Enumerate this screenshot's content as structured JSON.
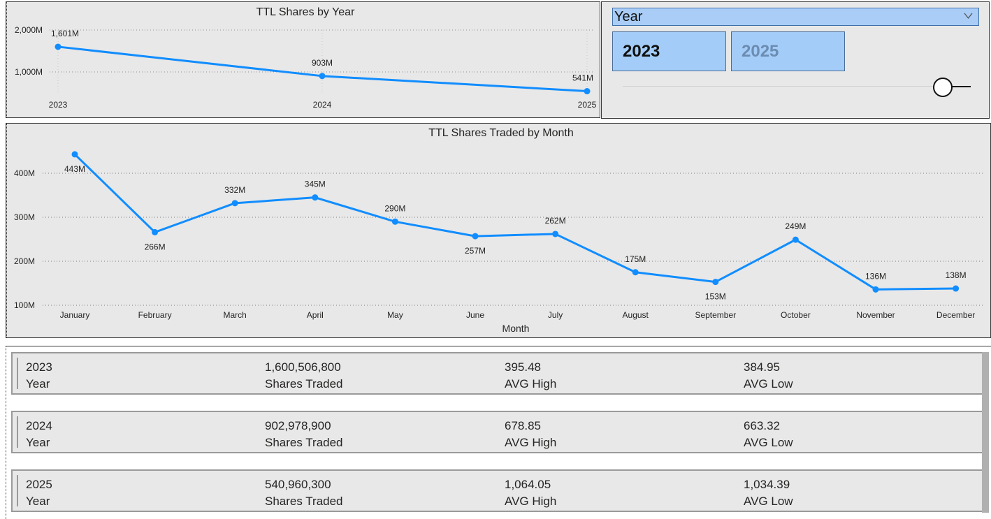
{
  "year_chart": {
    "title": "TTL Shares by Year",
    "chart_data": {
      "type": "line",
      "title": "TTL Shares by Year",
      "categories": [
        "2023",
        "2024",
        "2025"
      ],
      "values": [
        1601,
        903,
        541
      ],
      "value_unit": "M",
      "data_labels": [
        "1,601M",
        "903M",
        "541M"
      ],
      "yticks": [
        "1,000M",
        "2,000M"
      ],
      "ylim": [
        0,
        2000
      ],
      "grid": true,
      "line_color": "#118dff"
    }
  },
  "month_chart": {
    "title": "TTL Shares Traded by Month",
    "xlabel": "Month",
    "chart_data": {
      "type": "line",
      "title": "TTL Shares Traded by Month",
      "xlabel": "Month",
      "categories": [
        "January",
        "February",
        "March",
        "April",
        "May",
        "June",
        "July",
        "August",
        "September",
        "October",
        "November",
        "December"
      ],
      "values": [
        443,
        266,
        332,
        345,
        290,
        257,
        262,
        175,
        153,
        249,
        136,
        138
      ],
      "value_unit": "M",
      "data_labels": [
        "443M",
        "266M",
        "332M",
        "345M",
        "290M",
        "257M",
        "262M",
        "175M",
        "153M",
        "249M",
        "136M",
        "138M"
      ],
      "yticks": [
        "100M",
        "200M",
        "300M",
        "400M"
      ],
      "ylim": [
        100,
        400
      ],
      "grid": true,
      "line_color": "#118dff"
    }
  },
  "slicer": {
    "header": "Year",
    "options": [
      "2023",
      "2025"
    ],
    "selected": "2023",
    "icon": "chevron-down-icon",
    "header_color": "#a9cdf6",
    "tile_color": "#a3cdf8"
  },
  "cards": [
    {
      "year": "2023",
      "year_label": "Year",
      "shares": "1,600,506,800",
      "shares_label": "Shares Traded",
      "avg_high": "395.48",
      "avg_high_label": "AVG High",
      "avg_low": "384.95",
      "avg_low_label": "AVG Low"
    },
    {
      "year": "2024",
      "year_label": "Year",
      "shares": "902,978,900",
      "shares_label": "Shares Traded",
      "avg_high": "678.85",
      "avg_high_label": "AVG High",
      "avg_low": "663.32",
      "avg_low_label": "AVG Low"
    },
    {
      "year": "2025",
      "year_label": "Year",
      "shares": "540,960,300",
      "shares_label": "Shares Traded",
      "avg_high": "1,064.05",
      "avg_high_label": "AVG High",
      "avg_low": "1,034.39",
      "avg_low_label": "AVG Low"
    }
  ]
}
